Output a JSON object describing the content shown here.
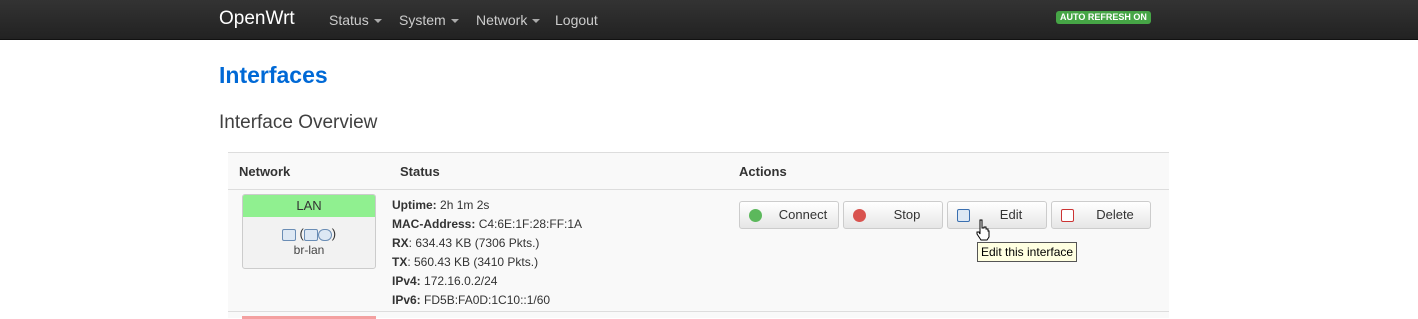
{
  "navbar": {
    "brand": "OpenWrt",
    "menus": [
      {
        "label": "Status"
      },
      {
        "label": "System"
      },
      {
        "label": "Network"
      },
      {
        "label": "Logout"
      }
    ],
    "auto_refresh": "AUTO REFRESH ON"
  },
  "page": {
    "title": "Interfaces",
    "section": "Interface Overview"
  },
  "table": {
    "headers": {
      "network": "Network",
      "status": "Status",
      "actions": "Actions"
    },
    "rows": [
      {
        "name": "LAN",
        "device": "br-lan",
        "status_lines": [
          {
            "label": "Uptime:",
            "value": "2h 1m 2s"
          },
          {
            "label": "MAC-Address:",
            "value": "C4:6E:1F:28:FF:1A"
          },
          {
            "label": "RX",
            "value": ": 634.43 KB (7306 Pkts.)"
          },
          {
            "label": "TX",
            "value": ": 560.43 KB (3410 Pkts.)"
          },
          {
            "label": "IPv4:",
            "value": "172.16.0.2/24"
          },
          {
            "label": "IPv6:",
            "value": "FD5B:FA0D:1C10::1/60"
          }
        ],
        "actions": {
          "connect": "Connect",
          "stop": "Stop",
          "edit": "Edit",
          "delete": "Delete"
        }
      }
    ]
  },
  "tooltip": "Edit this interface",
  "colors": {
    "accent": "#0069d6",
    "lan_header": "#90f090",
    "badge": "#46a546"
  },
  "icons": {
    "connect": "refresh-icon",
    "stop": "stop-icon",
    "edit": "edit-icon",
    "delete": "delete-icon"
  }
}
